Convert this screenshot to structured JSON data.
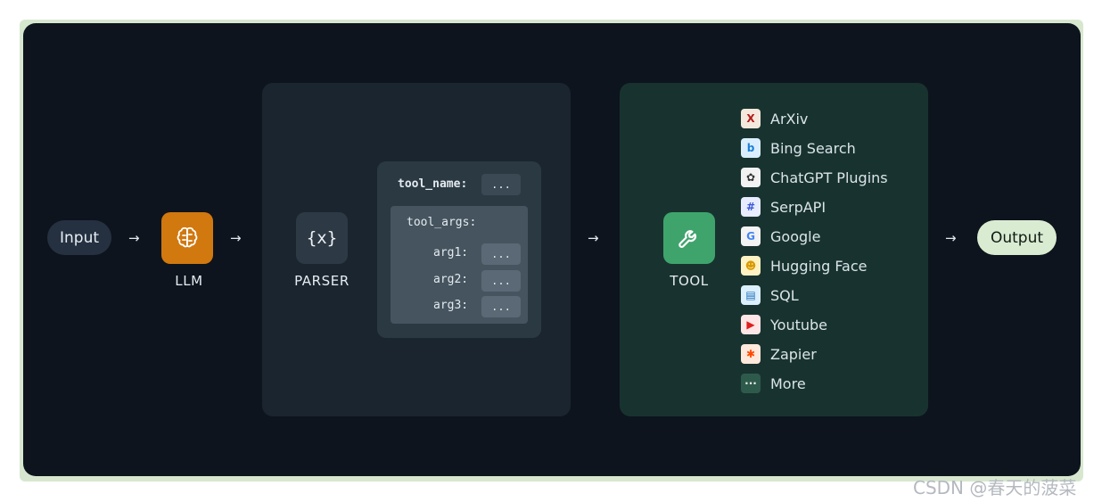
{
  "nodes": {
    "input": "Input",
    "llm": "LLM",
    "parser": "PARSER",
    "tool": "TOOL",
    "output": "Output",
    "parser_symbol": "{x}"
  },
  "arrow_glyph": "→",
  "schema": {
    "tool_name_key": "tool_name:",
    "tool_args_key": "tool_args:",
    "placeholder": "...",
    "args": [
      "arg1:",
      "arg2:",
      "arg3:"
    ]
  },
  "tools": [
    {
      "name": "ArXiv",
      "icon": "arxiv-icon",
      "color": "#f4e9dc"
    },
    {
      "name": "Bing Search",
      "icon": "bing-icon",
      "color": "#dbeeff"
    },
    {
      "name": "ChatGPT Plugins",
      "icon": "openai-icon",
      "color": "#f2f2f2"
    },
    {
      "name": "SerpAPI",
      "icon": "serpapi-icon",
      "color": "#e7ecff"
    },
    {
      "name": "Google",
      "icon": "google-icon",
      "color": "#f3f3f3"
    },
    {
      "name": "Hugging Face",
      "icon": "hugging-face-icon",
      "color": "#fff2c2"
    },
    {
      "name": "SQL",
      "icon": "sql-icon",
      "color": "#dcefff"
    },
    {
      "name": "Youtube",
      "icon": "youtube-icon",
      "color": "#ffe6e6"
    },
    {
      "name": "Zapier",
      "icon": "zapier-icon",
      "color": "#ffe9dc"
    },
    {
      "name": "More",
      "icon": "more-icon",
      "color": "#2e5a4c"
    }
  ],
  "colors": {
    "llm_accent": "#d1780f",
    "tool_accent": "#3fa46c",
    "parser_icon_bg": "#2d3a45"
  },
  "watermark": "CSDN @春天的菠菜"
}
